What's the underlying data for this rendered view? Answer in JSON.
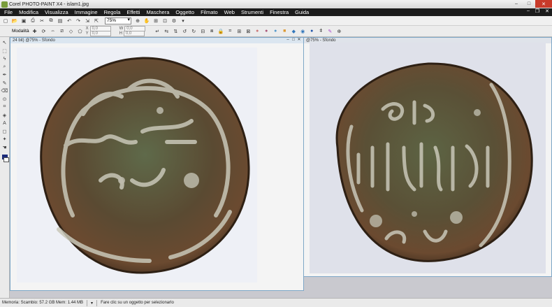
{
  "window": {
    "title": "Corel PHOTO-PAINT X4 - islam1.jpg",
    "minimize": "–",
    "maximize": "□",
    "close": "✕"
  },
  "menu": {
    "items": [
      "File",
      "Modifica",
      "Visualizza",
      "Immagine",
      "Regola",
      "Effetti",
      "Maschera",
      "Oggetto",
      "Filmato",
      "Web",
      "Strumenti",
      "Finestra",
      "Guida"
    ],
    "mdi_min": "–",
    "mdi_restore": "❐",
    "mdi_close": "✕"
  },
  "toolbar": {
    "zoom_value": "75%"
  },
  "property_bar": {
    "mode_label": "Modalità",
    "x_label": "X",
    "y_label": "Y",
    "w_label": "W",
    "h_label": "H",
    "x_value": "0,0",
    "y_value": "0,0",
    "w_value": "0,0",
    "h_value": "0,0"
  },
  "document1": {
    "title": "24 bit) @75% - Sfondo"
  },
  "document2": {
    "title": "@75% - Sfondo"
  },
  "status": {
    "memory": "Memoria: Scambio: 57.2 GB Mem: 1.44 MB",
    "hint": "Fare clic su un oggetto per selezionarlo"
  },
  "colors": {
    "menubar": "#1c1c1c",
    "coin_base": "#6b4a30",
    "coin_patina": "#5f6a4a",
    "coin_relief": "#c9c7b8",
    "foreground": "#1b2a7a"
  },
  "icons": [
    "new-icon",
    "open-icon",
    "save-icon",
    "print-icon",
    "cut-icon",
    "copy-icon",
    "paste-icon",
    "undo-icon",
    "redo-icon",
    "import-icon",
    "export-icon",
    "zoom-icon",
    "hand-icon",
    "pick-tool-icon",
    "mask-icon",
    "crop-icon",
    "eyedropper-icon",
    "brush-icon",
    "fill-icon",
    "eraser-icon",
    "text-icon"
  ]
}
